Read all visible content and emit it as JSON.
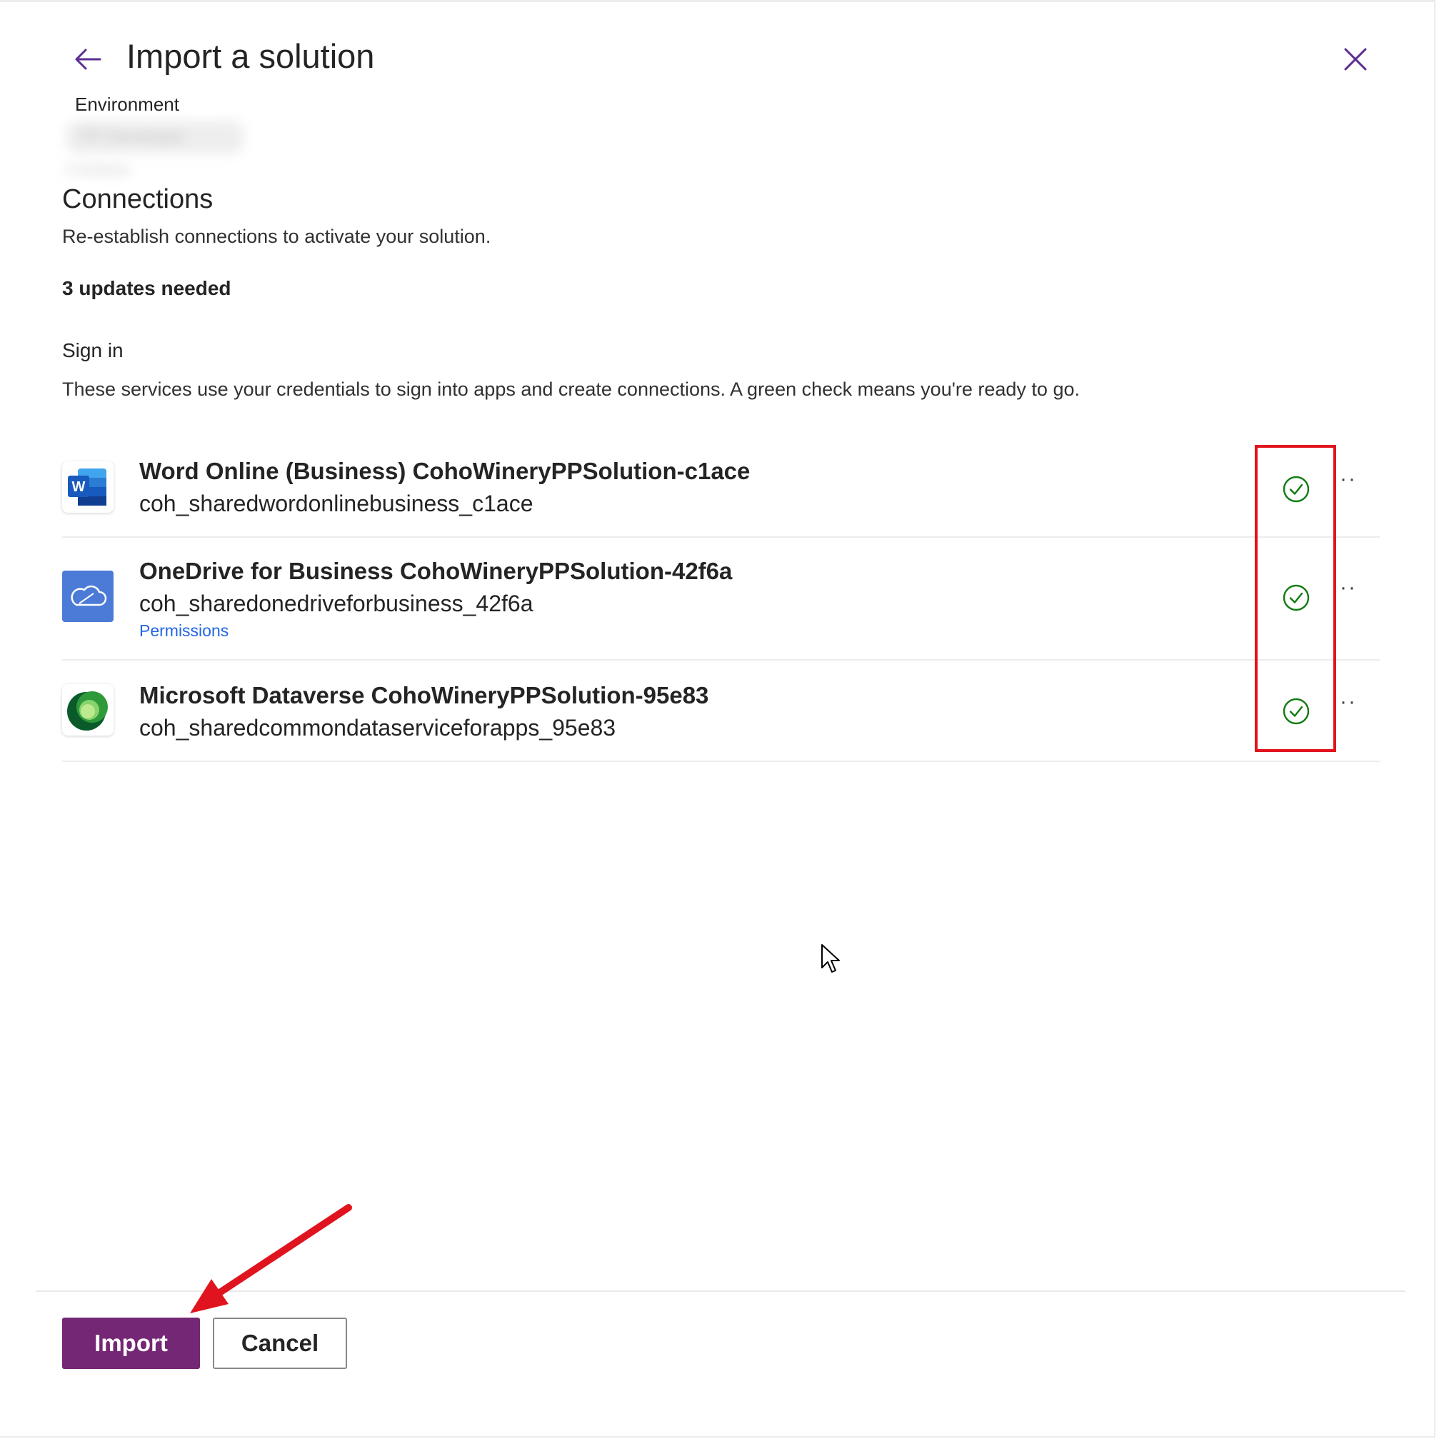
{
  "header": {
    "title": "Import a solution",
    "back_icon": "arrow-left-icon",
    "close_icon": "close-icon"
  },
  "environment": {
    "label": "Environment",
    "value": "PP Developer Contoso"
  },
  "connections": {
    "title": "Connections",
    "description": "Re-establish connections to activate your solution.",
    "updates_needed": "3 updates needed"
  },
  "signin": {
    "title": "Sign in",
    "description": "These services use your credentials to sign into apps and create connections. A green check means you're ready to go."
  },
  "rows": [
    {
      "name": "Word Online (Business) CohoWineryPPSolution-c1ace",
      "sub": "coh_sharedwordonlinebusiness_c1ace",
      "icon": "word-icon",
      "status": "ready"
    },
    {
      "name": "OneDrive for Business CohoWineryPPSolution-42f6a",
      "sub": "coh_sharedonedriveforbusiness_42f6a",
      "link": "Permissions",
      "icon": "onedrive-icon",
      "status": "ready"
    },
    {
      "name": "Microsoft Dataverse CohoWineryPPSolution-95e83",
      "sub": "coh_sharedcommondataserviceforapps_95e83",
      "icon": "dataverse-icon",
      "status": "ready"
    }
  ],
  "more_glyph": "···",
  "footer": {
    "import_label": "Import",
    "cancel_label": "Cancel"
  },
  "colors": {
    "primary": "#742774",
    "success": "#107c10",
    "annotation": "#e0141e",
    "link": "#2266e3"
  }
}
